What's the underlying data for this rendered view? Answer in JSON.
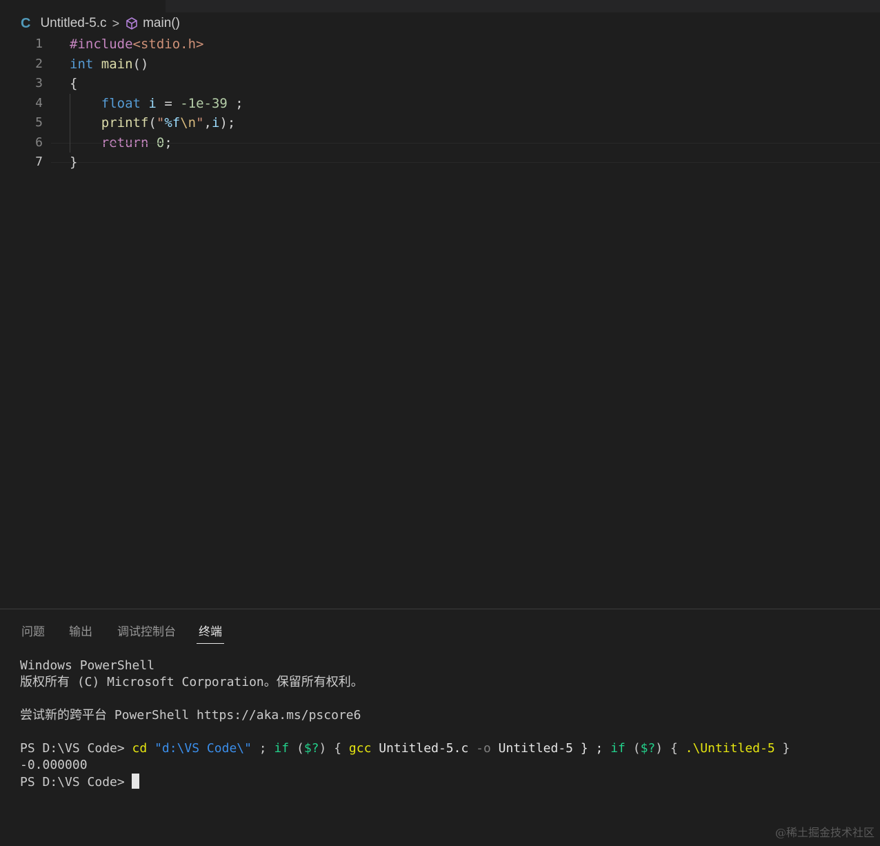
{
  "breadcrumb": {
    "lang_icon": "C",
    "file": "Untitled-5.c",
    "separator": ">",
    "symbol_icon": "cube-icon",
    "symbol": "main()"
  },
  "editor": {
    "active_line": 7,
    "lines": [
      {
        "no": "1",
        "tokens": [
          {
            "t": "#include",
            "c": "kw-pre"
          },
          {
            "t": "<stdio.h>",
            "c": "str"
          }
        ]
      },
      {
        "no": "2",
        "tokens": [
          {
            "t": "int",
            "c": "type"
          },
          {
            "t": " ",
            "c": ""
          },
          {
            "t": "main",
            "c": "fn"
          },
          {
            "t": "()",
            "c": ""
          }
        ]
      },
      {
        "no": "3",
        "tokens": [
          {
            "t": "{",
            "c": ""
          }
        ]
      },
      {
        "no": "4",
        "tokens": [
          {
            "t": "    ",
            "c": ""
          },
          {
            "t": "float",
            "c": "type"
          },
          {
            "t": " ",
            "c": ""
          },
          {
            "t": "i",
            "c": "var"
          },
          {
            "t": " = ",
            "c": ""
          },
          {
            "t": "-1e-39",
            "c": "num"
          },
          {
            "t": " ;",
            "c": ""
          }
        ]
      },
      {
        "no": "5",
        "tokens": [
          {
            "t": "    ",
            "c": ""
          },
          {
            "t": "printf",
            "c": "fn"
          },
          {
            "t": "(",
            "c": ""
          },
          {
            "t": "\"",
            "c": "str"
          },
          {
            "t": "%f",
            "c": "var"
          },
          {
            "t": "\\n",
            "c": "esc"
          },
          {
            "t": "\"",
            "c": "str"
          },
          {
            "t": ",",
            "c": ""
          },
          {
            "t": "i",
            "c": "var"
          },
          {
            "t": ");",
            "c": ""
          }
        ]
      },
      {
        "no": "6",
        "tokens": [
          {
            "t": "    ",
            "c": ""
          },
          {
            "t": "return",
            "c": "ret"
          },
          {
            "t": " ",
            "c": ""
          },
          {
            "t": "0",
            "c": "num"
          },
          {
            "t": ";",
            "c": ""
          }
        ]
      },
      {
        "no": "7",
        "tokens": [
          {
            "t": "}",
            "c": ""
          }
        ]
      }
    ]
  },
  "panel": {
    "tabs": [
      "问题",
      "输出",
      "调试控制台",
      "终端"
    ],
    "active_tab": "终端",
    "terminal": {
      "line1": "Windows PowerShell",
      "line2": "版权所有 (C) Microsoft Corporation。保留所有权利。",
      "line3": "尝试新的跨平台 PowerShell https://aka.ms/pscore6",
      "prompt": "PS D:\\VS Code>",
      "command": [
        {
          "t": " cd",
          "c": "t-yellow"
        },
        {
          "t": " \"d:\\VS Code\\\"",
          "c": "t-blue"
        },
        {
          "t": " ; ",
          "c": ""
        },
        {
          "t": "if",
          "c": "t-green"
        },
        {
          "t": " (",
          "c": ""
        },
        {
          "t": "$?",
          "c": "t-green"
        },
        {
          "t": ") { ",
          "c": ""
        },
        {
          "t": "gcc",
          "c": "t-yellow"
        },
        {
          "t": " Untitled-5.c ",
          "c": "t-white"
        },
        {
          "t": "-o",
          "c": "t-gray"
        },
        {
          "t": " Untitled-5 } ; ",
          "c": "t-white"
        },
        {
          "t": "if",
          "c": "t-green"
        },
        {
          "t": " (",
          "c": ""
        },
        {
          "t": "$?",
          "c": "t-green"
        },
        {
          "t": ") { ",
          "c": ""
        },
        {
          "t": ".\\Untitled-5",
          "c": "t-yellow"
        },
        {
          "t": " }",
          "c": ""
        }
      ],
      "output": "-0.000000",
      "prompt2": "PS D:\\VS Code>"
    }
  },
  "watermark": "@稀土掘金技术社区"
}
